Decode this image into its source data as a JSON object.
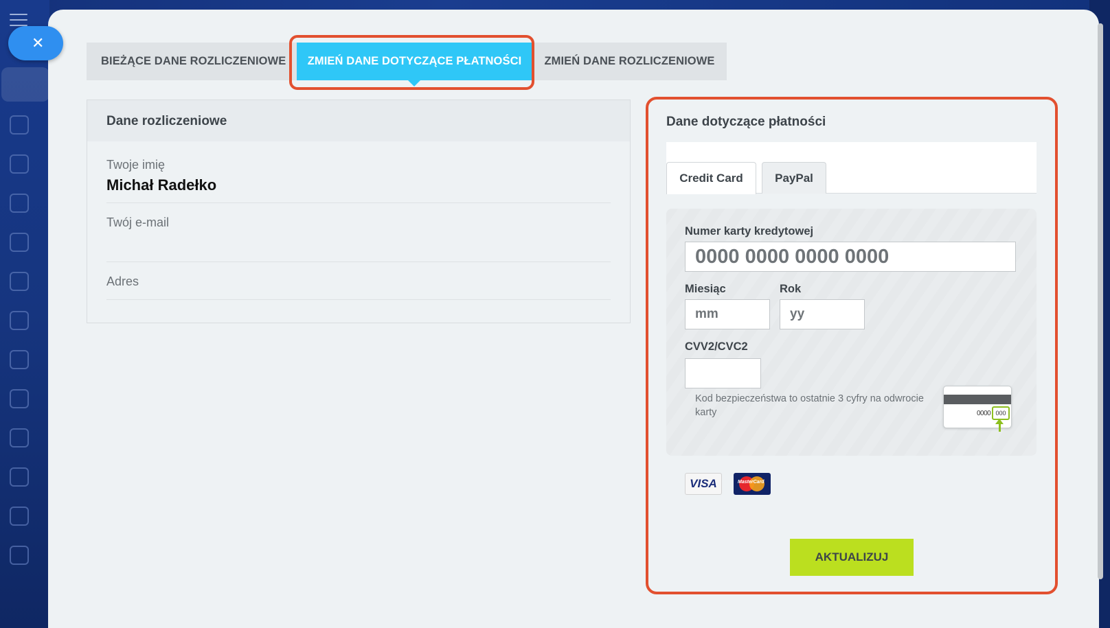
{
  "tabs": {
    "current_billing": "BIEŻĄCE DANE ROZLICZENIOWE",
    "change_payment": "ZMIEŃ DANE DOTYCZĄCE PŁATNOŚCI",
    "change_billing": "ZMIEŃ DANE ROZLICZENIOWE"
  },
  "billing": {
    "title": "Dane rozliczeniowe",
    "name_label": "Twoje imię",
    "name_value": "Michał Radełko",
    "email_label": "Twój e-mail",
    "email_value": "",
    "address_label": "Adres"
  },
  "payment": {
    "title": "Dane dotyczące płatności",
    "methods": [
      "Credit Card",
      "PayPal"
    ],
    "card_number_label": "Numer karty kredytowej",
    "card_number_placeholder": "0000 0000 0000 0000",
    "month_label": "Miesiąc",
    "month_placeholder": "mm",
    "year_label": "Rok",
    "year_placeholder": "yy",
    "cvv_label": "CVV2/CVC2",
    "cvv_hint": "Kod bezpieczeństwa to ostatnie 3 cyfry na odwrocie karty",
    "cvv_card_digits": "0000",
    "cvv_card_code": "000",
    "logos": [
      "VISA",
      "MasterCard"
    ],
    "submit_label": "AKTUALIZUJ"
  },
  "colors": {
    "active_tab": "#2fc7f7",
    "highlight": "#e2502f",
    "submit_button": "#bbdf1f"
  }
}
